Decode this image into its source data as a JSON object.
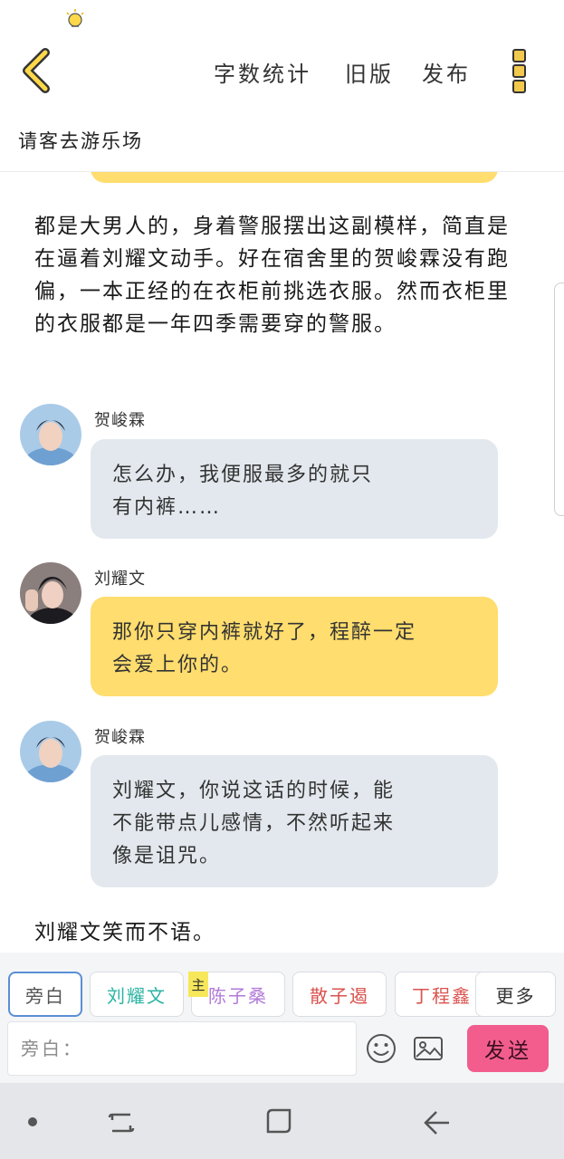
{
  "header": {
    "word_count_label": "字数统计",
    "old_version_label": "旧版",
    "publish_label": "发布"
  },
  "story_title": "请客去游乐场",
  "narration": [
    "都是大男人的，身着警服摆出这副模样，简直是在逼着刘耀文动手。好在宿舍里的贺峻霖没有跑偏，一本正经的在衣柜前挑选衣服。然而衣柜里的衣服都是一年四季需要穿的警服。",
    "刘耀文笑而不语。"
  ],
  "messages": [
    {
      "speaker": "贺峻霖",
      "lines": [
        "怎么办，我便服最多的就只",
        "有内裤……"
      ],
      "style": "grey"
    },
    {
      "speaker": "刘耀文",
      "lines": [
        "那你只穿内裤就好了，程醉一定",
        "会爱上你的。"
      ],
      "style": "yellow"
    },
    {
      "speaker": "贺峻霖",
      "lines": [
        "刘耀文，你说这话的时候，能",
        "不能带点儿感情，不然听起来",
        "像是诅咒。"
      ],
      "style": "grey"
    }
  ],
  "role_chips": [
    {
      "label": "旁白",
      "color": "#555555"
    },
    {
      "label": "刘耀文",
      "color": "#2bb3a3"
    },
    {
      "label": "陈子桑",
      "color": "#b27ad9"
    },
    {
      "label": "散子遏",
      "color": "#d9534f"
    },
    {
      "label": "丁程鑫",
      "color": "#d9534f"
    },
    {
      "label": "更多",
      "color": "#333333"
    }
  ],
  "main_role_tag": "主",
  "input": {
    "placeholder": "旁白："
  },
  "send_label": "发送",
  "colors": {
    "accent_yellow": "#ffdd6e",
    "bubble_grey": "#e3e8ee",
    "send_pink": "#f25d8e"
  }
}
